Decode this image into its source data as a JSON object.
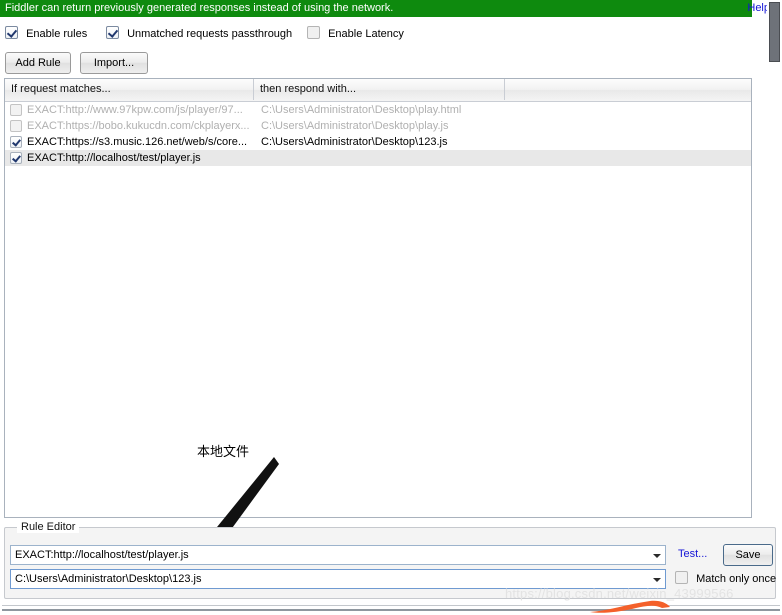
{
  "banner": {
    "message": "Fiddler can return previously generated responses instead of using the network.",
    "help_label": "Help",
    "background_color": "#0e8a0e",
    "text_color": "#ffffff",
    "help_color": "#1414d6"
  },
  "options": [
    {
      "label": "Enable rules",
      "checked": true,
      "enabled": true
    },
    {
      "label": "Unmatched requests passthrough",
      "checked": true,
      "enabled": true
    },
    {
      "label": "Enable Latency",
      "checked": false,
      "enabled": false
    }
  ],
  "toolbar": {
    "add_rule_label": "Add Rule",
    "import_label": "Import..."
  },
  "table": {
    "columns": [
      "If request matches...",
      "then respond with...",
      ""
    ],
    "rows": [
      {
        "checked": false,
        "enabled": false,
        "selected": false,
        "match": "EXACT:http://www.97kpw.com/js/player/97...",
        "respond": "C:\\Users\\Administrator\\Desktop\\play.html"
      },
      {
        "checked": false,
        "enabled": false,
        "selected": false,
        "match": "EXACT:https://bobo.kukucdn.com/ckplayerx...",
        "respond": "C:\\Users\\Administrator\\Desktop\\play.js"
      },
      {
        "checked": true,
        "enabled": true,
        "selected": false,
        "match": "EXACT:https://s3.music.126.net/web/s/core...",
        "respond": "C:\\Users\\Administrator\\Desktop\\123.js"
      },
      {
        "checked": true,
        "enabled": true,
        "selected": true,
        "match": "EXACT:http://localhost/test/player.js",
        "respond": ""
      }
    ]
  },
  "annotation": {
    "text": "本地文件"
  },
  "rule_editor": {
    "legend": "Rule Editor",
    "match_value": "EXACT:http://localhost/test/player.js",
    "respond_value": "C:\\Users\\Administrator\\Desktop\\123.js",
    "test_label": "Test...",
    "save_label": "Save",
    "match_only_once_label": "Match only once",
    "match_only_once_checked": false
  },
  "watermark": {
    "text": "https://blog.csdn.net/weixin_43999566",
    "color": "#e3e3e3"
  }
}
